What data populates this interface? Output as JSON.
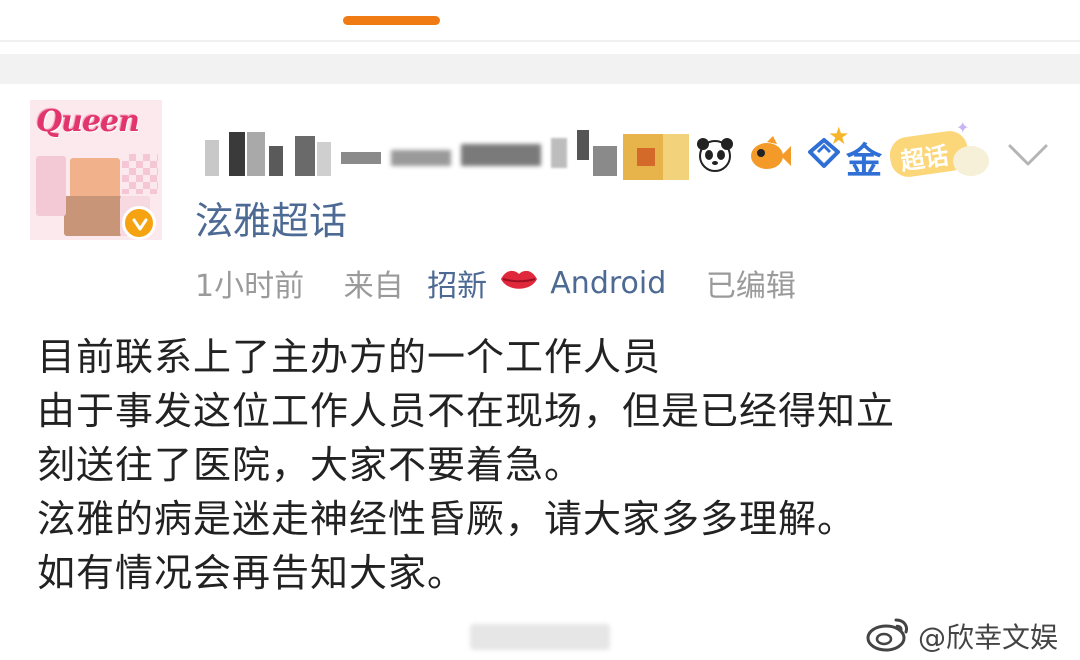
{
  "post": {
    "supertopic": "泫雅超话",
    "gold_char": "金",
    "chaohua_badge": "超话",
    "meta": {
      "time": "1小时前",
      "from_label": "来自",
      "client_prefix": "招新",
      "client_name": "Android",
      "edited": "已编辑"
    },
    "body": [
      "目前联系上了主办方的一个工作人员",
      "由于事发这位工作人员不在现场，但是已经得知立",
      "刻送往了医院，大家不要着急。",
      "泫雅的病是迷走神经性昏厥，请大家多多理解。",
      "如有情况会再告知大家。"
    ]
  },
  "avatar": {
    "logo_text": "Queen"
  },
  "watermark": {
    "text": "@欣幸文娱"
  },
  "colors": {
    "accent": "#f07a14",
    "link": "#4d6a94",
    "meta": "#9a9a9a",
    "body": "#222222",
    "verified": "#f5a310"
  },
  "icons": [
    "verified-badge-icon",
    "panda-emoji-icon",
    "fish-emoji-icon",
    "diamond-icon",
    "lips-emoji-icon",
    "chevron-down-icon",
    "weibo-logo-icon"
  ]
}
